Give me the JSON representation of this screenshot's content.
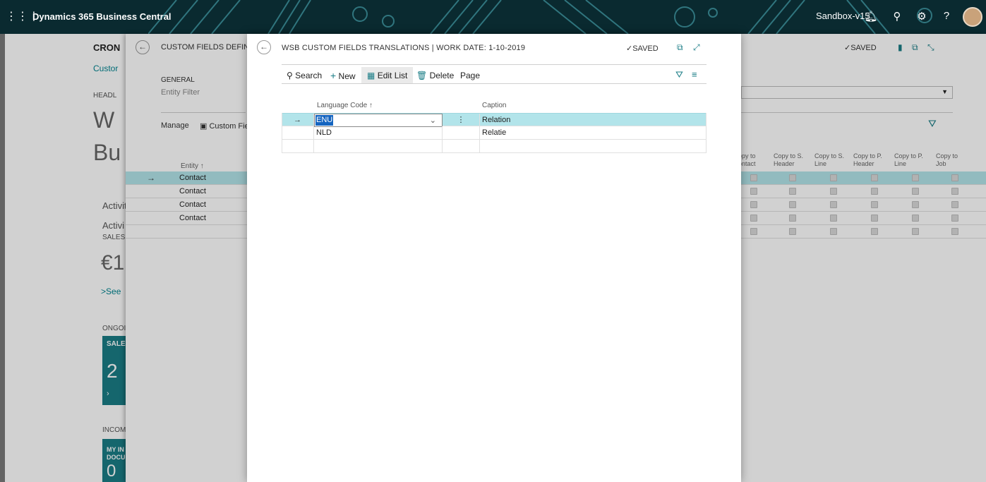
{
  "topbar": {
    "app_title": "Dynamics 365 Business Central",
    "environment": "Sandbox-v15",
    "icons": [
      "waffle-icon",
      "bell-icon",
      "search-icon",
      "gear-icon",
      "help-icon"
    ]
  },
  "role_center": {
    "company_short": "CRON",
    "company_link": "Custor",
    "headline_label": "HEADL",
    "headline_text_1": "W",
    "headline_text_2": "Bu",
    "activities_1": "Activit",
    "activities_2": "Activi",
    "sales_label": "SALES",
    "amount": "€1",
    "see_more": "See",
    "ongoing": "ONGOIN",
    "tile_sales_label": "SALES",
    "tile_sales_value": "2",
    "incoming": "INCOMI",
    "tile_inc_label_1": "MY IN",
    "tile_inc_label_2": "DOCU",
    "tile_inc_value": "0"
  },
  "definitions_page": {
    "title": "CUSTOM FIELDS DEFINITIO",
    "saved": "SAVED",
    "general": "GENERAL",
    "entity_filter_label": "Entity Filter",
    "manage": "Manage",
    "custom_fields": "Custom Fiel",
    "entity_header": "Entity ↑",
    "rows": [
      "Contact",
      "Contact",
      "Contact",
      "Contact"
    ],
    "columns": [
      {
        "l1": "opy to",
        "l2": "ontact"
      },
      {
        "l1": "Copy to S.",
        "l2": "Header"
      },
      {
        "l1": "Copy to S.",
        "l2": "Line"
      },
      {
        "l1": "Copy to P.",
        "l2": "Header"
      },
      {
        "l1": "Copy to P.",
        "l2": "Line"
      },
      {
        "l1": "Copy to",
        "l2": "Job"
      }
    ]
  },
  "modal": {
    "title": "WSB CUSTOM FIELDS TRANSLATIONS | WORK DATE: 1-10-2019",
    "saved": "SAVED",
    "actions": {
      "search": "Search",
      "new": "New",
      "edit_list": "Edit List",
      "delete": "Delete",
      "page": "Page"
    },
    "columns": {
      "language_code": "Language Code ↑",
      "caption": "Caption"
    },
    "rows": [
      {
        "language_code": "ENU",
        "caption": "Relation"
      },
      {
        "language_code": "NLD",
        "caption": "Relatie"
      }
    ]
  }
}
